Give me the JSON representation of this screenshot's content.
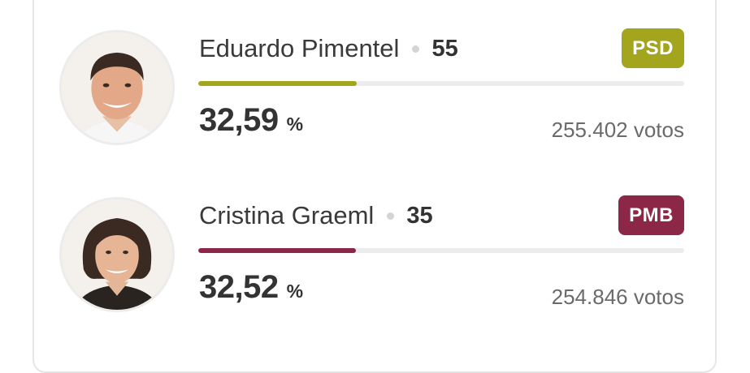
{
  "candidates": [
    {
      "name": "Eduardo Pimentel",
      "number": "55",
      "party": "PSD",
      "party_color": "#a3a51c",
      "percent": "32,59",
      "percent_unit": "%",
      "votes": "255.402 votos",
      "bar_fraction": 0.3259,
      "avatar_icon": "man-portrait-icon"
    },
    {
      "name": "Cristina Graeml",
      "number": "35",
      "party": "PMB",
      "party_color": "#8c2747",
      "percent": "32,52",
      "percent_unit": "%",
      "votes": "254.846 votos",
      "bar_fraction": 0.3252,
      "avatar_icon": "woman-portrait-icon"
    }
  ]
}
